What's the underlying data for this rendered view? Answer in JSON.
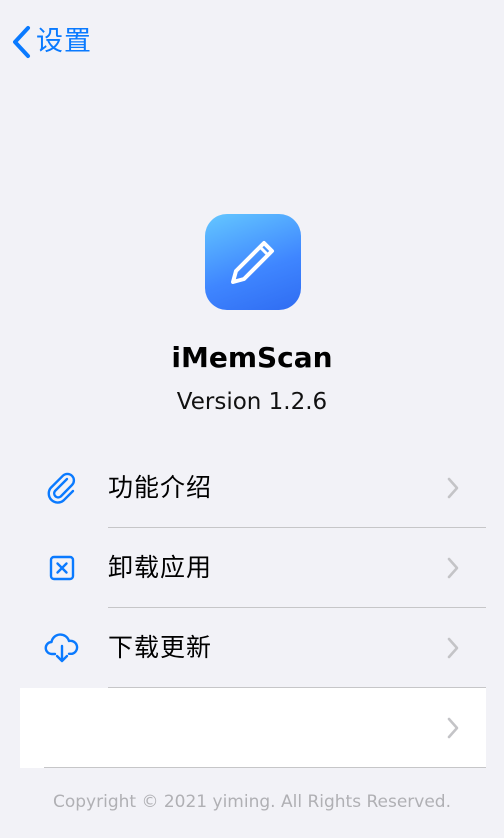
{
  "nav": {
    "back_label": "设置"
  },
  "app": {
    "name": "iMemScan",
    "version": "Version 1.2.6",
    "icon": "pencil-icon",
    "icon_gradient": [
      "#64c7ff",
      "#2f6cf2"
    ]
  },
  "menu": {
    "items": [
      {
        "label": "功能介绍",
        "icon": "paperclip-icon"
      },
      {
        "label": "卸载应用",
        "icon": "xmark-square-icon"
      },
      {
        "label": "下载更新",
        "icon": "cloud-download-icon"
      },
      {
        "label": "",
        "icon": ""
      }
    ]
  },
  "footer": {
    "copyright": "Copyright © 2021 yiming. All Rights Reserved."
  },
  "colors": {
    "accent": "#0a7aff",
    "background": "#f2f2f7",
    "separator": "#c6c6c8",
    "chevron": "#c4c4c7"
  }
}
